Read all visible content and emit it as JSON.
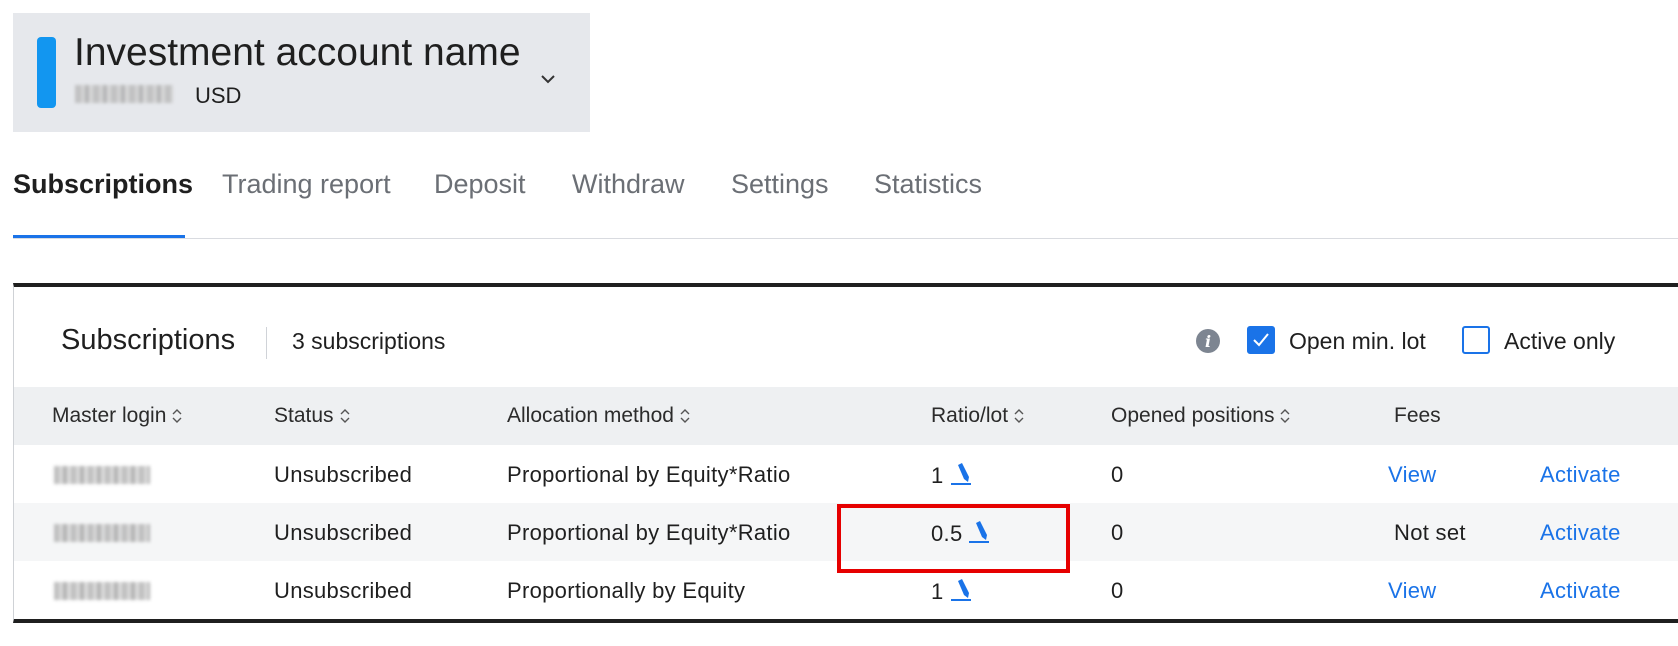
{
  "account": {
    "name": "Investment account name",
    "currency": "USD",
    "accent_color": "#1296f0"
  },
  "tabs": [
    {
      "label": "Subscriptions",
      "active": true
    },
    {
      "label": "Trading report",
      "active": false
    },
    {
      "label": "Deposit",
      "active": false
    },
    {
      "label": "Withdraw",
      "active": false
    },
    {
      "label": "Settings",
      "active": false
    },
    {
      "label": "Statistics",
      "active": false
    }
  ],
  "panel": {
    "title": "Subscriptions",
    "count": "3 subscriptions",
    "open_min_lot_label": "Open min. lot",
    "open_min_lot_checked": true,
    "active_only_label": "Active only",
    "active_only_checked": false
  },
  "table": {
    "columns": [
      "Master login",
      "Status",
      "Allocation method",
      "Ratio/lot",
      "Opened positions",
      "Fees"
    ],
    "rows": [
      {
        "status": "Unsubscribed",
        "allocation": "Proportional by Equity*Ratio",
        "ratio": "1",
        "opened": "0",
        "fees": "View",
        "action": "Activate"
      },
      {
        "status": "Unsubscribed",
        "allocation": "Proportional by Equity*Ratio",
        "ratio": "0.5",
        "opened": "0",
        "fees": "Not set",
        "action": "Activate"
      },
      {
        "status": "Unsubscribed",
        "allocation": "Proportionally by Equity",
        "ratio": "1",
        "opened": "0",
        "fees": "View",
        "action": "Activate"
      }
    ]
  },
  "colors": {
    "link": "#1a73e8",
    "highlight": "#e60000"
  }
}
